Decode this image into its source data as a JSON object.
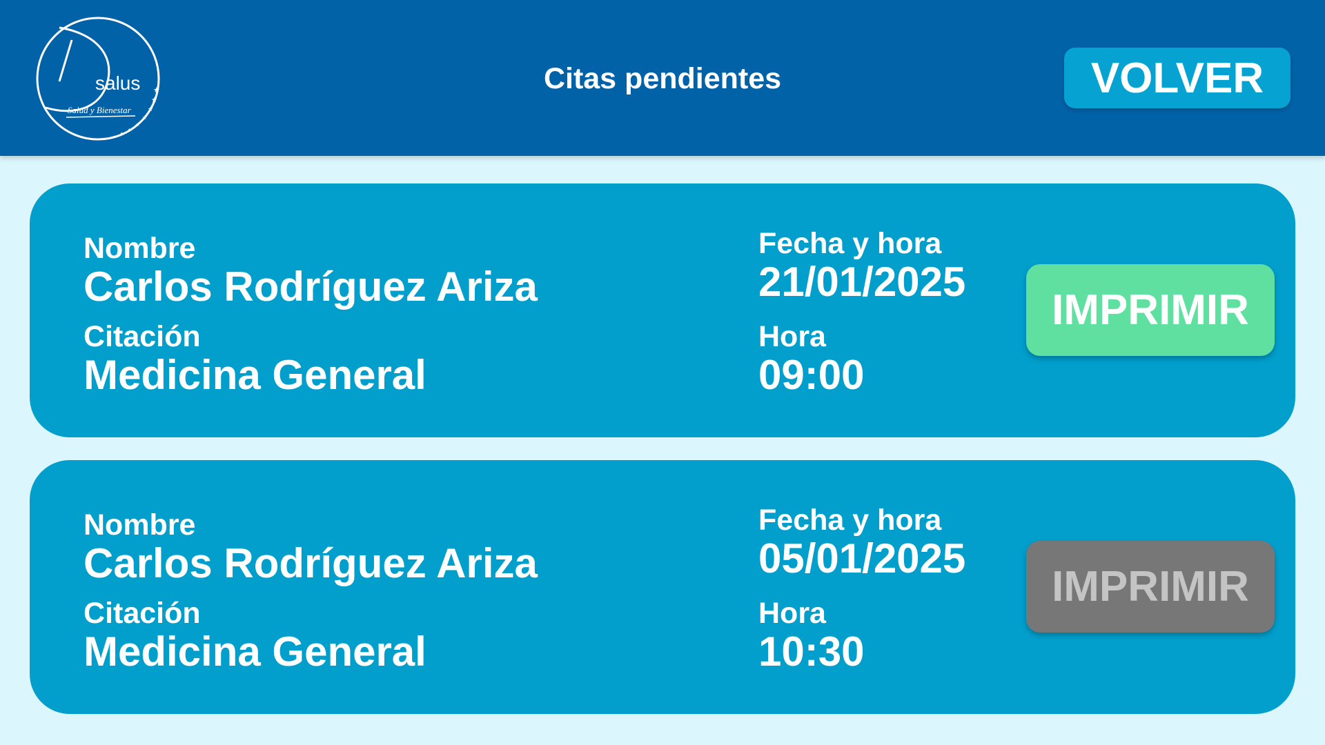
{
  "header": {
    "logo_text": "salus",
    "logo_tagline": "Salud y Bienestar",
    "title": "Citas pendientes",
    "back_label": "VOLVER"
  },
  "colors": {
    "header_bg": "#0262a8",
    "page_bg": "#dbf6fc",
    "card_bg": "#029fcd",
    "print_enabled": "#5fe0a1",
    "print_disabled": "#777777"
  },
  "appointments": [
    {
      "name_label": "Nombre",
      "name": "Carlos Rodríguez Ariza",
      "citation_label": "Citación",
      "citation": "Medicina General",
      "date_label": "Fecha y hora",
      "date": "21/01/2025",
      "time_label": "Hora",
      "time": "09:00",
      "print_label": "IMPRIMIR",
      "print_enabled": true
    },
    {
      "name_label": "Nombre",
      "name": "Carlos Rodríguez Ariza",
      "citation_label": "Citación",
      "citation": "Medicina General",
      "date_label": "Fecha y hora",
      "date": "05/01/2025",
      "time_label": "Hora",
      "time": "10:30",
      "print_label": "IMPRIMIR",
      "print_enabled": false
    }
  ]
}
